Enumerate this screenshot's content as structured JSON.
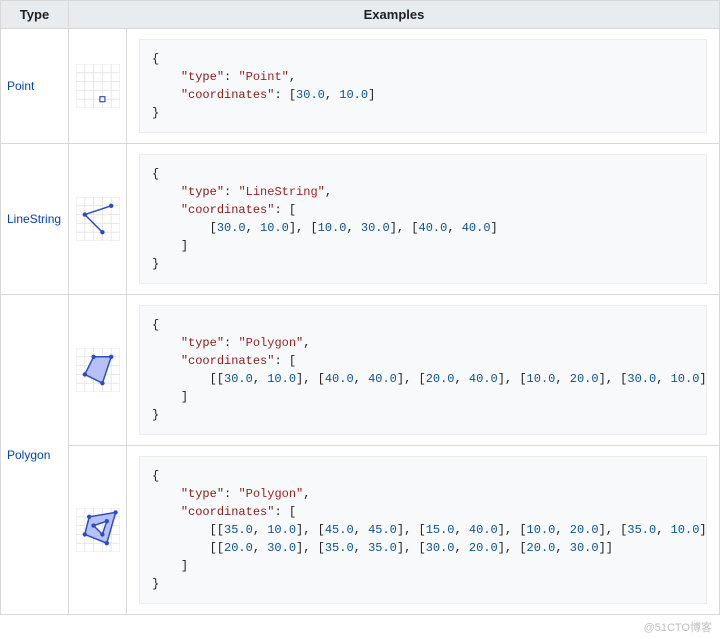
{
  "headers": {
    "type": "Type",
    "examples": "Examples"
  },
  "rows": [
    {
      "name": "Point",
      "icon": "point-icon",
      "examples": [
        {
          "tokens": [
            {
              "c": "p",
              "t": "{"
            },
            {
              "c": "nl"
            },
            {
              "c": "ind",
              "n": 1
            },
            {
              "c": "key",
              "t": "\"type\""
            },
            {
              "c": "p",
              "t": ": "
            },
            {
              "c": "str",
              "t": "\"Point\""
            },
            {
              "c": "p",
              "t": ","
            },
            {
              "c": "nl"
            },
            {
              "c": "ind",
              "n": 1
            },
            {
              "c": "key",
              "t": "\"coordinates\""
            },
            {
              "c": "p",
              "t": ": ["
            },
            {
              "c": "num",
              "t": "30.0"
            },
            {
              "c": "p",
              "t": ", "
            },
            {
              "c": "num",
              "t": "10.0"
            },
            {
              "c": "p",
              "t": "]"
            },
            {
              "c": "nl"
            },
            {
              "c": "p",
              "t": "}"
            }
          ]
        }
      ]
    },
    {
      "name": "LineString",
      "icon": "linestring-icon",
      "examples": [
        {
          "tokens": [
            {
              "c": "p",
              "t": "{"
            },
            {
              "c": "nl"
            },
            {
              "c": "ind",
              "n": 1
            },
            {
              "c": "key",
              "t": "\"type\""
            },
            {
              "c": "p",
              "t": ": "
            },
            {
              "c": "str",
              "t": "\"LineString\""
            },
            {
              "c": "p",
              "t": ","
            },
            {
              "c": "nl"
            },
            {
              "c": "ind",
              "n": 1
            },
            {
              "c": "key",
              "t": "\"coordinates\""
            },
            {
              "c": "p",
              "t": ": ["
            },
            {
              "c": "nl"
            },
            {
              "c": "ind",
              "n": 2
            },
            {
              "c": "p",
              "t": "["
            },
            {
              "c": "num",
              "t": "30.0"
            },
            {
              "c": "p",
              "t": ", "
            },
            {
              "c": "num",
              "t": "10.0"
            },
            {
              "c": "p",
              "t": "], ["
            },
            {
              "c": "num",
              "t": "10.0"
            },
            {
              "c": "p",
              "t": ", "
            },
            {
              "c": "num",
              "t": "30.0"
            },
            {
              "c": "p",
              "t": "], ["
            },
            {
              "c": "num",
              "t": "40.0"
            },
            {
              "c": "p",
              "t": ", "
            },
            {
              "c": "num",
              "t": "40.0"
            },
            {
              "c": "p",
              "t": "]"
            },
            {
              "c": "nl"
            },
            {
              "c": "ind",
              "n": 1
            },
            {
              "c": "p",
              "t": "]"
            },
            {
              "c": "nl"
            },
            {
              "c": "p",
              "t": "}"
            }
          ]
        }
      ]
    },
    {
      "name": "Polygon",
      "icon": "polygon-icon",
      "examples": [
        {
          "icon": "polygon-icon",
          "tokens": [
            {
              "c": "p",
              "t": "{"
            },
            {
              "c": "nl"
            },
            {
              "c": "ind",
              "n": 1
            },
            {
              "c": "key",
              "t": "\"type\""
            },
            {
              "c": "p",
              "t": ": "
            },
            {
              "c": "str",
              "t": "\"Polygon\""
            },
            {
              "c": "p",
              "t": ","
            },
            {
              "c": "nl"
            },
            {
              "c": "ind",
              "n": 1
            },
            {
              "c": "key",
              "t": "\"coordinates\""
            },
            {
              "c": "p",
              "t": ": ["
            },
            {
              "c": "nl"
            },
            {
              "c": "ind",
              "n": 2
            },
            {
              "c": "p",
              "t": "[["
            },
            {
              "c": "num",
              "t": "30.0"
            },
            {
              "c": "p",
              "t": ", "
            },
            {
              "c": "num",
              "t": "10.0"
            },
            {
              "c": "p",
              "t": "], ["
            },
            {
              "c": "num",
              "t": "40.0"
            },
            {
              "c": "p",
              "t": ", "
            },
            {
              "c": "num",
              "t": "40.0"
            },
            {
              "c": "p",
              "t": "], ["
            },
            {
              "c": "num",
              "t": "20.0"
            },
            {
              "c": "p",
              "t": ", "
            },
            {
              "c": "num",
              "t": "40.0"
            },
            {
              "c": "p",
              "t": "], ["
            },
            {
              "c": "num",
              "t": "10.0"
            },
            {
              "c": "p",
              "t": ", "
            },
            {
              "c": "num",
              "t": "20.0"
            },
            {
              "c": "p",
              "t": "], ["
            },
            {
              "c": "num",
              "t": "30.0"
            },
            {
              "c": "p",
              "t": ", "
            },
            {
              "c": "num",
              "t": "10.0"
            },
            {
              "c": "p",
              "t": "]]"
            },
            {
              "c": "nl"
            },
            {
              "c": "ind",
              "n": 1
            },
            {
              "c": "p",
              "t": "]"
            },
            {
              "c": "nl"
            },
            {
              "c": "p",
              "t": "}"
            }
          ]
        },
        {
          "icon": "polygon-hole-icon",
          "tokens": [
            {
              "c": "p",
              "t": "{"
            },
            {
              "c": "nl"
            },
            {
              "c": "ind",
              "n": 1
            },
            {
              "c": "key",
              "t": "\"type\""
            },
            {
              "c": "p",
              "t": ": "
            },
            {
              "c": "str",
              "t": "\"Polygon\""
            },
            {
              "c": "p",
              "t": ","
            },
            {
              "c": "nl"
            },
            {
              "c": "ind",
              "n": 1
            },
            {
              "c": "key",
              "t": "\"coordinates\""
            },
            {
              "c": "p",
              "t": ": ["
            },
            {
              "c": "nl"
            },
            {
              "c": "ind",
              "n": 2
            },
            {
              "c": "p",
              "t": "[["
            },
            {
              "c": "num",
              "t": "35.0"
            },
            {
              "c": "p",
              "t": ", "
            },
            {
              "c": "num",
              "t": "10.0"
            },
            {
              "c": "p",
              "t": "], ["
            },
            {
              "c": "num",
              "t": "45.0"
            },
            {
              "c": "p",
              "t": ", "
            },
            {
              "c": "num",
              "t": "45.0"
            },
            {
              "c": "p",
              "t": "], ["
            },
            {
              "c": "num",
              "t": "15.0"
            },
            {
              "c": "p",
              "t": ", "
            },
            {
              "c": "num",
              "t": "40.0"
            },
            {
              "c": "p",
              "t": "], ["
            },
            {
              "c": "num",
              "t": "10.0"
            },
            {
              "c": "p",
              "t": ", "
            },
            {
              "c": "num",
              "t": "20.0"
            },
            {
              "c": "p",
              "t": "], ["
            },
            {
              "c": "num",
              "t": "35.0"
            },
            {
              "c": "p",
              "t": ", "
            },
            {
              "c": "num",
              "t": "10.0"
            },
            {
              "c": "p",
              "t": "]],"
            },
            {
              "c": "nl"
            },
            {
              "c": "ind",
              "n": 2
            },
            {
              "c": "p",
              "t": "[["
            },
            {
              "c": "num",
              "t": "20.0"
            },
            {
              "c": "p",
              "t": ", "
            },
            {
              "c": "num",
              "t": "30.0"
            },
            {
              "c": "p",
              "t": "], ["
            },
            {
              "c": "num",
              "t": "35.0"
            },
            {
              "c": "p",
              "t": ", "
            },
            {
              "c": "num",
              "t": "35.0"
            },
            {
              "c": "p",
              "t": "], ["
            },
            {
              "c": "num",
              "t": "30.0"
            },
            {
              "c": "p",
              "t": ", "
            },
            {
              "c": "num",
              "t": "20.0"
            },
            {
              "c": "p",
              "t": "], ["
            },
            {
              "c": "num",
              "t": "20.0"
            },
            {
              "c": "p",
              "t": ", "
            },
            {
              "c": "num",
              "t": "30.0"
            },
            {
              "c": "p",
              "t": "]]"
            },
            {
              "c": "nl"
            },
            {
              "c": "ind",
              "n": 1
            },
            {
              "c": "p",
              "t": "]"
            },
            {
              "c": "nl"
            },
            {
              "c": "p",
              "t": "}"
            }
          ]
        }
      ]
    }
  ],
  "watermark": "@51CTO博客"
}
